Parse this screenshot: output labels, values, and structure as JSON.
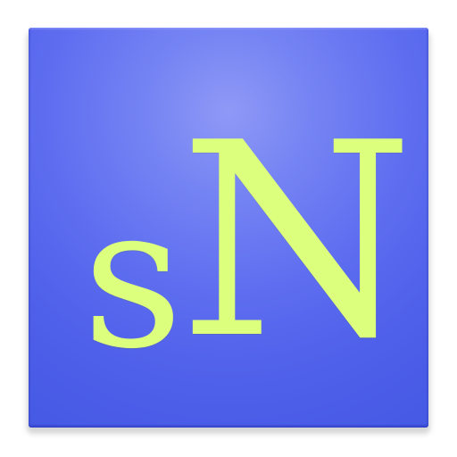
{
  "app_icon": {
    "logo_text_first": "s",
    "logo_text_second": "N",
    "colors": {
      "tile_base": "#5f6ef0",
      "tile_highlight": "#8f99f6",
      "logo_text": "#ddff7e"
    }
  }
}
